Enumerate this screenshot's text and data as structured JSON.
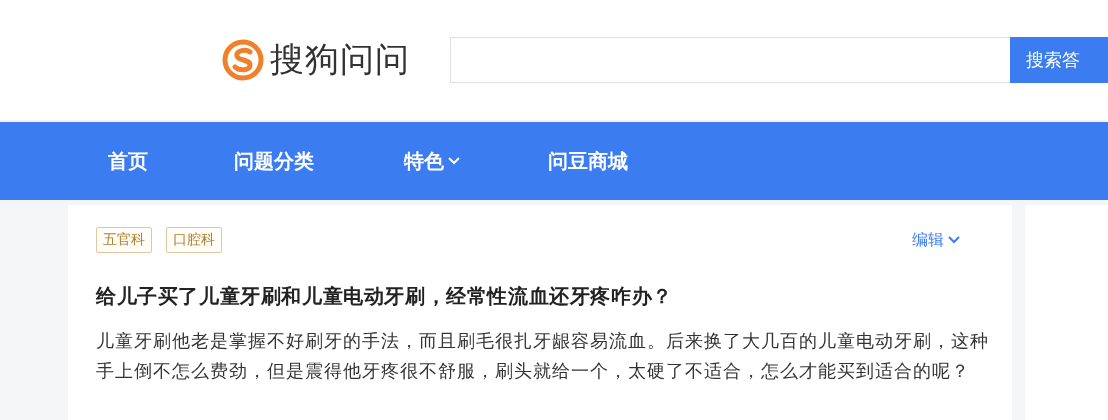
{
  "header": {
    "logo_text": "搜狗问问",
    "search_button": "搜索答"
  },
  "nav": {
    "items": [
      {
        "label": "首页",
        "dropdown": false
      },
      {
        "label": "问题分类",
        "dropdown": false
      },
      {
        "label": "特色",
        "dropdown": true
      },
      {
        "label": "问豆商城",
        "dropdown": false
      }
    ]
  },
  "question": {
    "tags": [
      "五官科",
      "口腔科"
    ],
    "edit": "编辑",
    "title": "给儿子买了儿童牙刷和儿童电动牙刷，经常性流血还牙疼咋办？",
    "body": "儿童牙刷他老是掌握不好刷牙的手法，而且刷毛很扎牙龈容易流血。后来换了大几百的儿童电动牙刷，这种手上倒不怎么费劲，但是震得他牙疼很不舒服，刷头就给一个，太硬了不适合，怎么才能买到适合的呢？"
  }
}
